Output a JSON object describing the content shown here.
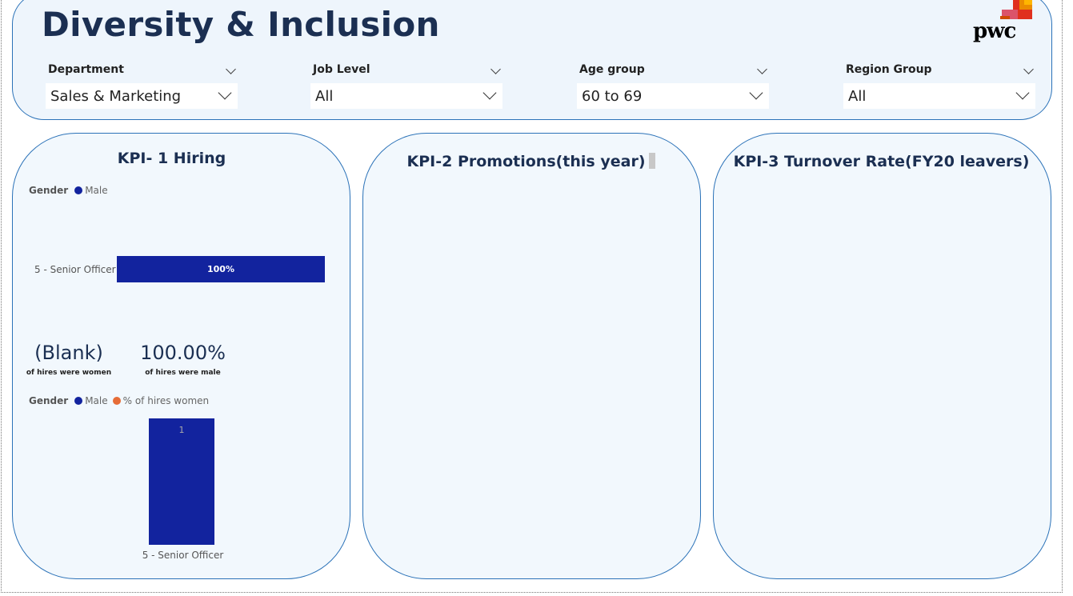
{
  "header": {
    "title": "Diversity & Inclusion",
    "logo_text": "pwc"
  },
  "filters": [
    {
      "label": "Department",
      "value": "Sales & Marketing"
    },
    {
      "label": "Job Level",
      "value": "All"
    },
    {
      "label": "Age group",
      "value": "60 to 69"
    },
    {
      "label": "Region Group",
      "value": "All"
    }
  ],
  "panels": {
    "kpi1": {
      "title": "KPI- 1 Hiring",
      "legend1": {
        "title": "Gender",
        "items": [
          {
            "label": "Male",
            "color": "#12239e"
          }
        ]
      },
      "bar": {
        "category": "5 - Senior Officer",
        "value_label": "100%"
      },
      "women_value": "(Blank)",
      "women_caption": "of hires were women",
      "male_value": "100.00%",
      "male_caption": "of hires were male",
      "legend2": {
        "title": "Gender",
        "items": [
          {
            "label": "Male",
            "color": "#12239e"
          },
          {
            "label": "% of hires women",
            "color": "#e66c37"
          }
        ]
      },
      "column": {
        "category": "5 - Senior Officer",
        "value_label": "1"
      }
    },
    "kpi2": {
      "title": "KPI-2 Promotions(this year)"
    },
    "kpi3": {
      "title": "KPI-3 Turnover Rate(FY20 leavers)"
    }
  },
  "chart_data": [
    {
      "type": "bar",
      "categories": [
        "5 - Senior Officer"
      ],
      "series": [
        {
          "name": "Male",
          "values": [
            100
          ]
        }
      ],
      "data_labels": [
        "100%"
      ]
    },
    {
      "type": "bar",
      "categories": [
        "5 - Senior Officer"
      ],
      "series": [
        {
          "name": "Male",
          "values": [
            1
          ]
        },
        {
          "name": "% of hires women",
          "values": [
            0
          ]
        }
      ],
      "data_labels": [
        "1"
      ]
    }
  ]
}
